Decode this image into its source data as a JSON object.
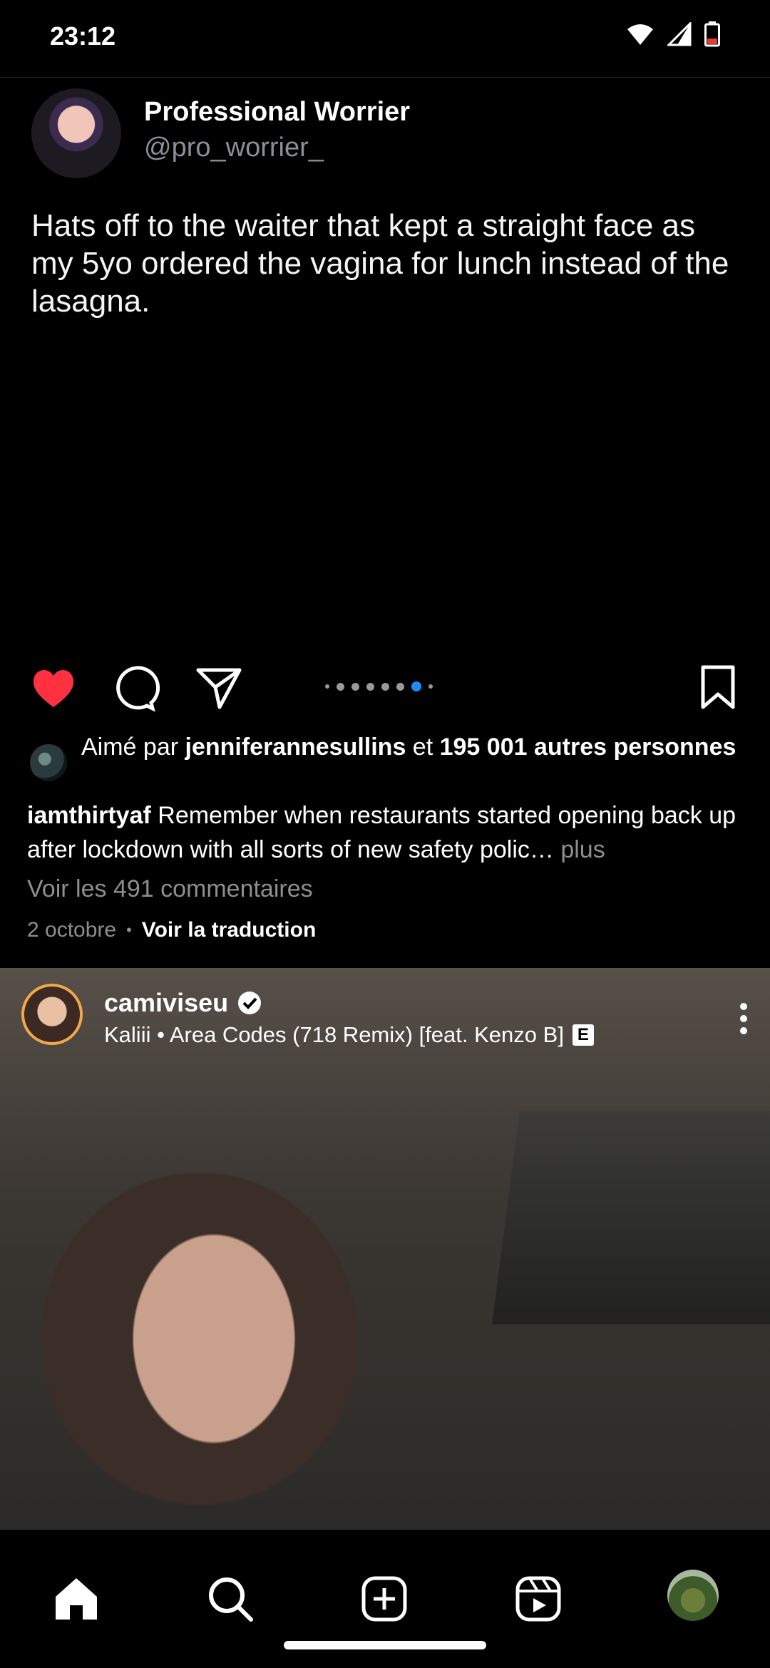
{
  "status_bar": {
    "time": "23:12",
    "icons": [
      "wifi-icon",
      "signal-icon",
      "battery-icon"
    ]
  },
  "tweet": {
    "display_name": "Professional Worrier",
    "handle": "@pro_worrier_",
    "text": "Hats off to the waiter that kept a straight face as my 5yo ordered the vagina for lunch instead of the lasagna."
  },
  "actions": {
    "icons": [
      "heart-icon",
      "comment-icon",
      "share-icon",
      "bookmark-icon"
    ],
    "carousel_index": 6,
    "carousel_count": 8
  },
  "likes": {
    "prefix": "Aimé par ",
    "user": "jenniferannesullins",
    "middle": " et ",
    "count": "195 001 autres personnes"
  },
  "caption": {
    "user": "iamthirtyaf",
    "text": " Remember when restaurants started opening back up after lockdown with all sorts of new safety polic…",
    "more": " plus"
  },
  "comments_link": "Voir les 491 commentaires",
  "date": "2 octobre",
  "separator": "•",
  "translate_link": "Voir la traduction",
  "reel": {
    "username": "camiviseu",
    "song": "Kaliii • Area Codes (718 Remix) [feat. Kenzo B]",
    "explicit": "E"
  },
  "nav": {
    "icons": [
      "home-icon",
      "search-icon",
      "create-icon",
      "reels-icon",
      "profile-avatar"
    ]
  }
}
